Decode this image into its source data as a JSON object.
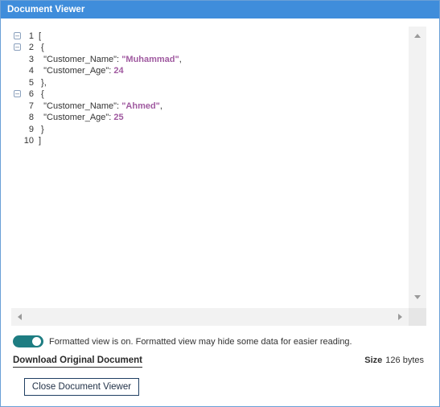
{
  "window": {
    "title": "Document Viewer"
  },
  "editor": {
    "lines": [
      {
        "num": "1",
        "text": "["
      },
      {
        "num": "2",
        "text": " {"
      },
      {
        "num": "3",
        "key": "  \"Customer_Name\": ",
        "value": "\"Muhammad\"",
        "tail": ","
      },
      {
        "num": "4",
        "key": "  \"Customer_Age\": ",
        "value": "24",
        "tail": ""
      },
      {
        "num": "5",
        "text": " },"
      },
      {
        "num": "6",
        "text": " {"
      },
      {
        "num": "7",
        "key": "  \"Customer_Name\": ",
        "value": "\"Ahmed\"",
        "tail": ","
      },
      {
        "num": "8",
        "key": "  \"Customer_Age\": ",
        "value": "25",
        "tail": ""
      },
      {
        "num": "9",
        "text": " }"
      },
      {
        "num": "10",
        "text": "]"
      }
    ],
    "fold_icon": "minus-box-icon"
  },
  "formatted_toggle": {
    "on": true,
    "text": "Formatted view is on. Formatted view may hide some data for easier reading."
  },
  "download": {
    "label": "Download Original Document"
  },
  "size": {
    "label": "Size",
    "value": "126 bytes"
  },
  "close_button": {
    "label": "Close Document Viewer"
  },
  "colors": {
    "titlebar": "#3f8ddb",
    "toggle": "#1e7d82",
    "json_value": "#a05aa0"
  }
}
